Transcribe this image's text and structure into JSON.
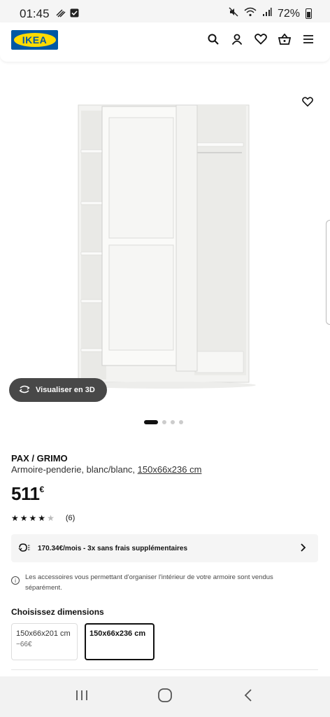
{
  "status_bar": {
    "time": "01:45",
    "battery": "72%",
    "left_icons": [
      "wifi-calling-icon",
      "check-box-icon"
    ],
    "right_icons": [
      "mute-icon",
      "wifi-icon",
      "signal-icon",
      "battery-icon"
    ]
  },
  "header": {
    "logo_text": "IKEA",
    "icons": [
      "search-icon",
      "account-icon",
      "favorite-icon",
      "basket-icon",
      "menu-icon"
    ]
  },
  "hero": {
    "view_3d_label": "Visualiser en 3D",
    "slide_count": 4,
    "active_slide": 1
  },
  "product": {
    "name": "PAX / GRIMO",
    "description": "Armoire-penderie, blanc/blanc, ",
    "dimensions_link": "150x66x236 cm",
    "price": "511",
    "currency": "€",
    "rating": 4.5,
    "rating_max": 5,
    "review_count": "(6)"
  },
  "payment": {
    "text": "170.34€/mois - 3x sans frais supplémentaires"
  },
  "info": {
    "text": "Les accessoires vous permettant d'organiser l'intérieur de votre armoire sont vendus séparément."
  },
  "dimensions": {
    "title": "Choisissez dimensions",
    "options": [
      {
        "label": "150x66x201 cm",
        "price_diff": "−66€",
        "selected": false
      },
      {
        "label": "150x66x236 cm",
        "price_diff": "",
        "selected": true
      }
    ]
  },
  "colors": {
    "ikea_blue": "#0058a3",
    "ikea_yellow": "#ffdb00",
    "button_dark": "#484848"
  }
}
